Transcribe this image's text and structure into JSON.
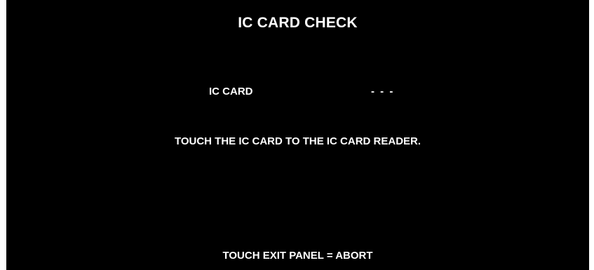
{
  "screen": {
    "title": "IC CARD CHECK",
    "status": {
      "label": "IC CARD",
      "value": "- - -"
    },
    "instruction": "TOUCH THE IC CARD TO THE IC CARD READER.",
    "footer": "TOUCH EXIT PANEL = ABORT"
  },
  "colors": {
    "background": "#000000",
    "text": "#ffffff"
  }
}
